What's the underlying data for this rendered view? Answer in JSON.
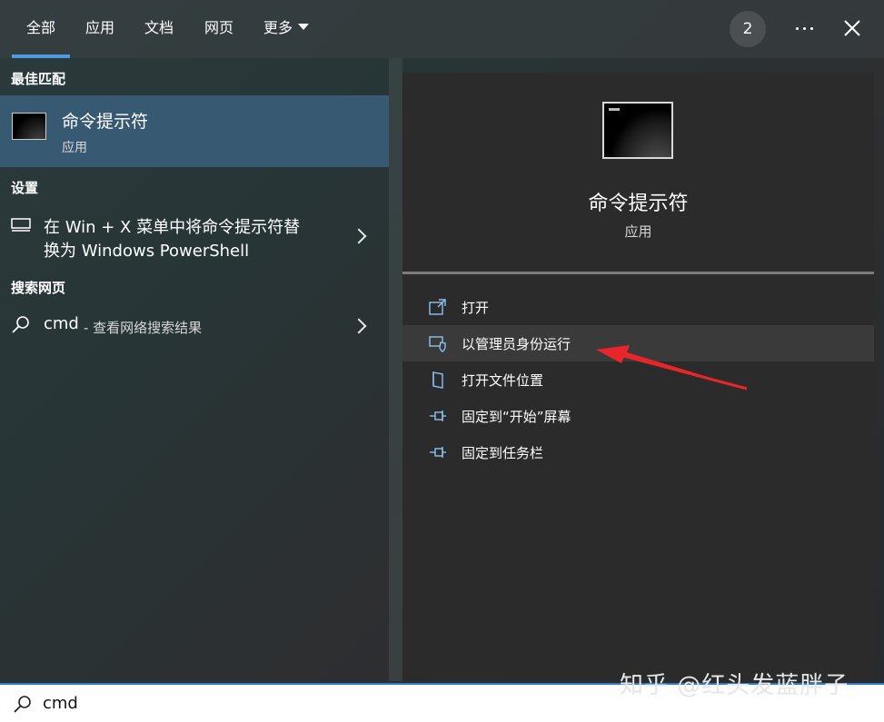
{
  "tabs": [
    {
      "label": "全部"
    },
    {
      "label": "应用"
    },
    {
      "label": "文档"
    },
    {
      "label": "网页"
    },
    {
      "label": "更多"
    }
  ],
  "header": {
    "badge_count": "2"
  },
  "left": {
    "best_match_title": "最佳匹配",
    "best_match": {
      "title": "命令提示符",
      "subtitle": "应用"
    },
    "settings_title": "设置",
    "setting_item": {
      "line1": "在 Win + X 菜单中将命令提示符替",
      "line2": "换为 Windows PowerShell"
    },
    "web_title": "搜索网页",
    "web_item": {
      "query": "cmd",
      "suffix": "- 查看网络搜索结果"
    }
  },
  "detail": {
    "title": "命令提示符",
    "subtitle": "应用",
    "actions": [
      {
        "label": "打开",
        "icon": "open-icon"
      },
      {
        "label": "以管理员身份运行",
        "icon": "shield-icon"
      },
      {
        "label": "打开文件位置",
        "icon": "file-location-icon"
      },
      {
        "label": "固定到“开始”屏幕",
        "icon": "pin-icon"
      },
      {
        "label": "固定到任务栏",
        "icon": "pin-icon"
      }
    ]
  },
  "search": {
    "value": "cmd"
  },
  "watermark": "知乎 @红头发蓝胖子",
  "colors": {
    "accent": "#4b9be0",
    "selected": "#375a72",
    "arrow": "#e8262a"
  }
}
